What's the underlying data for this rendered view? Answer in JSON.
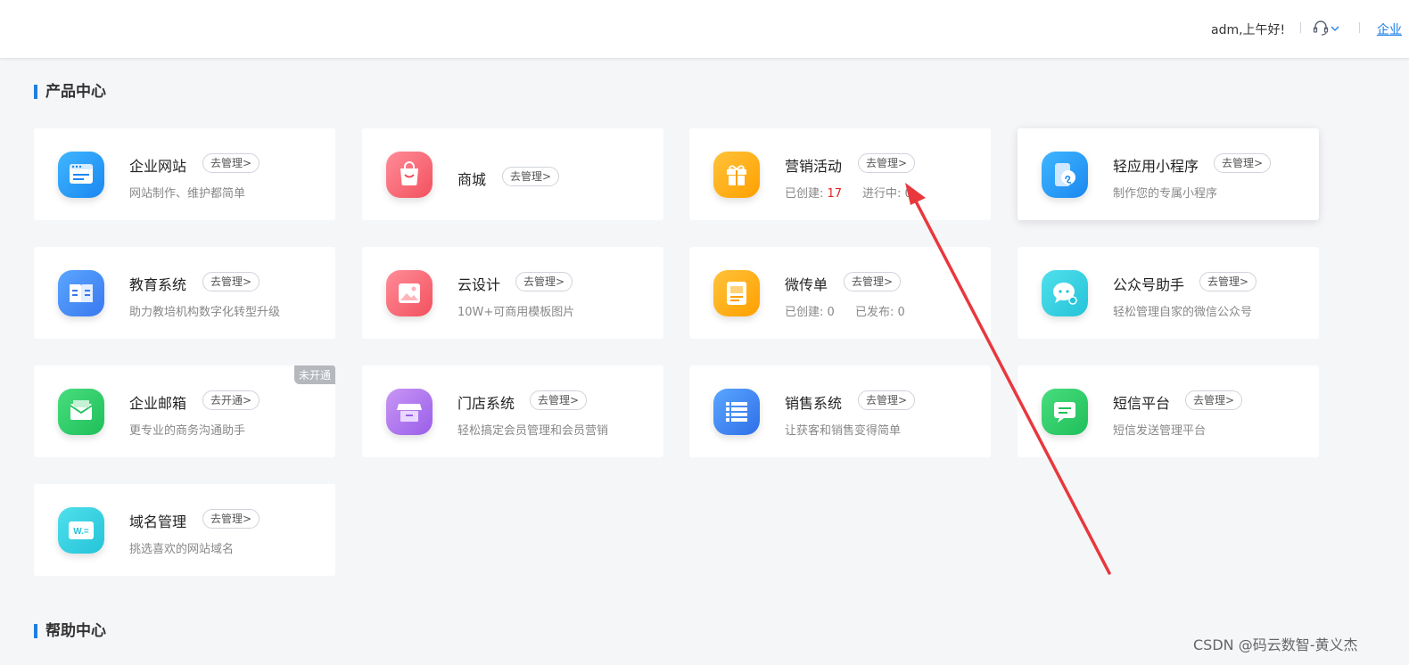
{
  "header": {
    "greeting": "adm,上午好!",
    "enterprise_link": "企业"
  },
  "sections": {
    "products": "产品中心",
    "help": "帮助中心"
  },
  "cards": {
    "website": {
      "name": "企业网站",
      "action": "去管理>",
      "desc": "网站制作、维护都简单"
    },
    "mall": {
      "name": "商城",
      "action": "去管理>"
    },
    "marketing": {
      "name": "营销活动",
      "action": "去管理>",
      "created_label": "已创建:",
      "created_value": "17",
      "running_label": "进行中:",
      "running_value": "0"
    },
    "miniapp": {
      "name": "轻应用小程序",
      "action": "去管理>",
      "desc": "制作您的专属小程序"
    },
    "education": {
      "name": "教育系统",
      "action": "去管理>",
      "desc": "助力教培机构数字化转型升级"
    },
    "cloud_design": {
      "name": "云设计",
      "action": "去管理>",
      "desc": "10W+可商用模板图片"
    },
    "flyer": {
      "name": "微传单",
      "action": "去管理>",
      "created_label": "已创建:",
      "created_value": "0",
      "published_label": "已发布:",
      "published_value": "0"
    },
    "wechat_assistant": {
      "name": "公众号助手",
      "action": "去管理>",
      "desc": "轻松管理自家的微信公众号"
    },
    "mail": {
      "name": "企业邮箱",
      "action": "去开通>",
      "desc": "更专业的商务沟通助手",
      "badge": "未开通"
    },
    "store": {
      "name": "门店系统",
      "action": "去管理>",
      "desc": "轻松搞定会员管理和会员营销"
    },
    "sales": {
      "name": "销售系统",
      "action": "去管理>",
      "desc": "让获客和销售变得简单"
    },
    "sms": {
      "name": "短信平台",
      "action": "去管理>",
      "desc": "短信发送管理平台"
    },
    "domain": {
      "name": "域名管理",
      "action": "去管理>",
      "desc": "挑选喜欢的网站域名",
      "icon_text": "W.="
    }
  },
  "watermark": "CSDN @码云数智-黄义杰",
  "colors": {
    "accent": "#1f7fe0",
    "highlight_red": "#e62222",
    "annotation_arrow": "#e8383d"
  },
  "icons": [
    "browser-window-icon",
    "shopping-bag-icon",
    "gift-icon",
    "mini-program-icon",
    "book-icon",
    "image-icon",
    "flyer-icon",
    "chat-bubble-icon",
    "mail-icon",
    "store-icon",
    "list-icon",
    "sms-icon",
    "domain-icon",
    "headset-icon",
    "chevron-down-icon"
  ]
}
